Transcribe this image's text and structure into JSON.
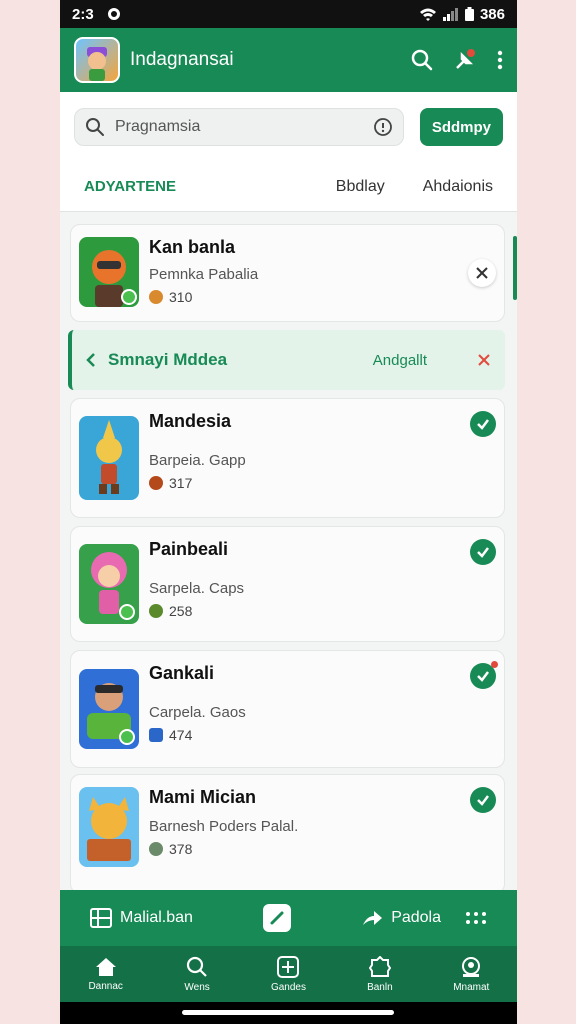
{
  "status_bar": {
    "time": "2:3",
    "battery": "386"
  },
  "app_bar": {
    "title": "Indagnansai"
  },
  "search": {
    "placeholder": "Pragnamsia",
    "button_label": "Sddmpy"
  },
  "tabs": [
    {
      "label": "ADYARTENE",
      "active": true
    },
    {
      "label": "Bbdlay",
      "active": false
    },
    {
      "label": "Ahdaionis",
      "active": false
    }
  ],
  "items": [
    {
      "name": "Kan banla",
      "subtitle": "Pemnka Pabalia",
      "price": "310",
      "status": "dismiss",
      "thumb_colors": [
        "#2d9a3e",
        "#e8742c"
      ]
    },
    {
      "name": "Mandesia",
      "subtitle": "Barpeia. Gapp",
      "price": "317",
      "status": "checked",
      "thumb_colors": [
        "#3aa6d8",
        "#f1c74a"
      ]
    },
    {
      "name": "Painbeali",
      "subtitle": "Sarpela. Caps",
      "price": "258",
      "status": "checked",
      "thumb_colors": [
        "#36a04a",
        "#e86ab0"
      ]
    },
    {
      "name": "Gankali",
      "subtitle": "Carpela. Gaos",
      "price": "474",
      "status": "checked",
      "thumb_colors": [
        "#2f6fd6",
        "#58b43a"
      ]
    },
    {
      "name": "Mami Mician",
      "subtitle": "Barnesh Poders Palal.",
      "price": "378",
      "status": "checked",
      "thumb_colors": [
        "#6ac0ee",
        "#f2b43a"
      ]
    }
  ],
  "banner": {
    "title": "Smnayi Mddea",
    "action": "Andgallt"
  },
  "action_bar": {
    "left_label": "Malial.ban",
    "right_label": "Padola"
  },
  "bottom_nav": [
    {
      "label": "Dannac",
      "icon": "home-icon"
    },
    {
      "label": "Wens",
      "icon": "search-icon"
    },
    {
      "label": "Gandes",
      "icon": "plus-square-icon"
    },
    {
      "label": "Banln",
      "icon": "badge-icon"
    },
    {
      "label": "Mnamat",
      "icon": "profile-icon"
    }
  ],
  "colors": {
    "primary": "#188a56",
    "primary_dark": "#147046",
    "accent_red": "#e24b3c",
    "background": "#f3f5f4"
  }
}
